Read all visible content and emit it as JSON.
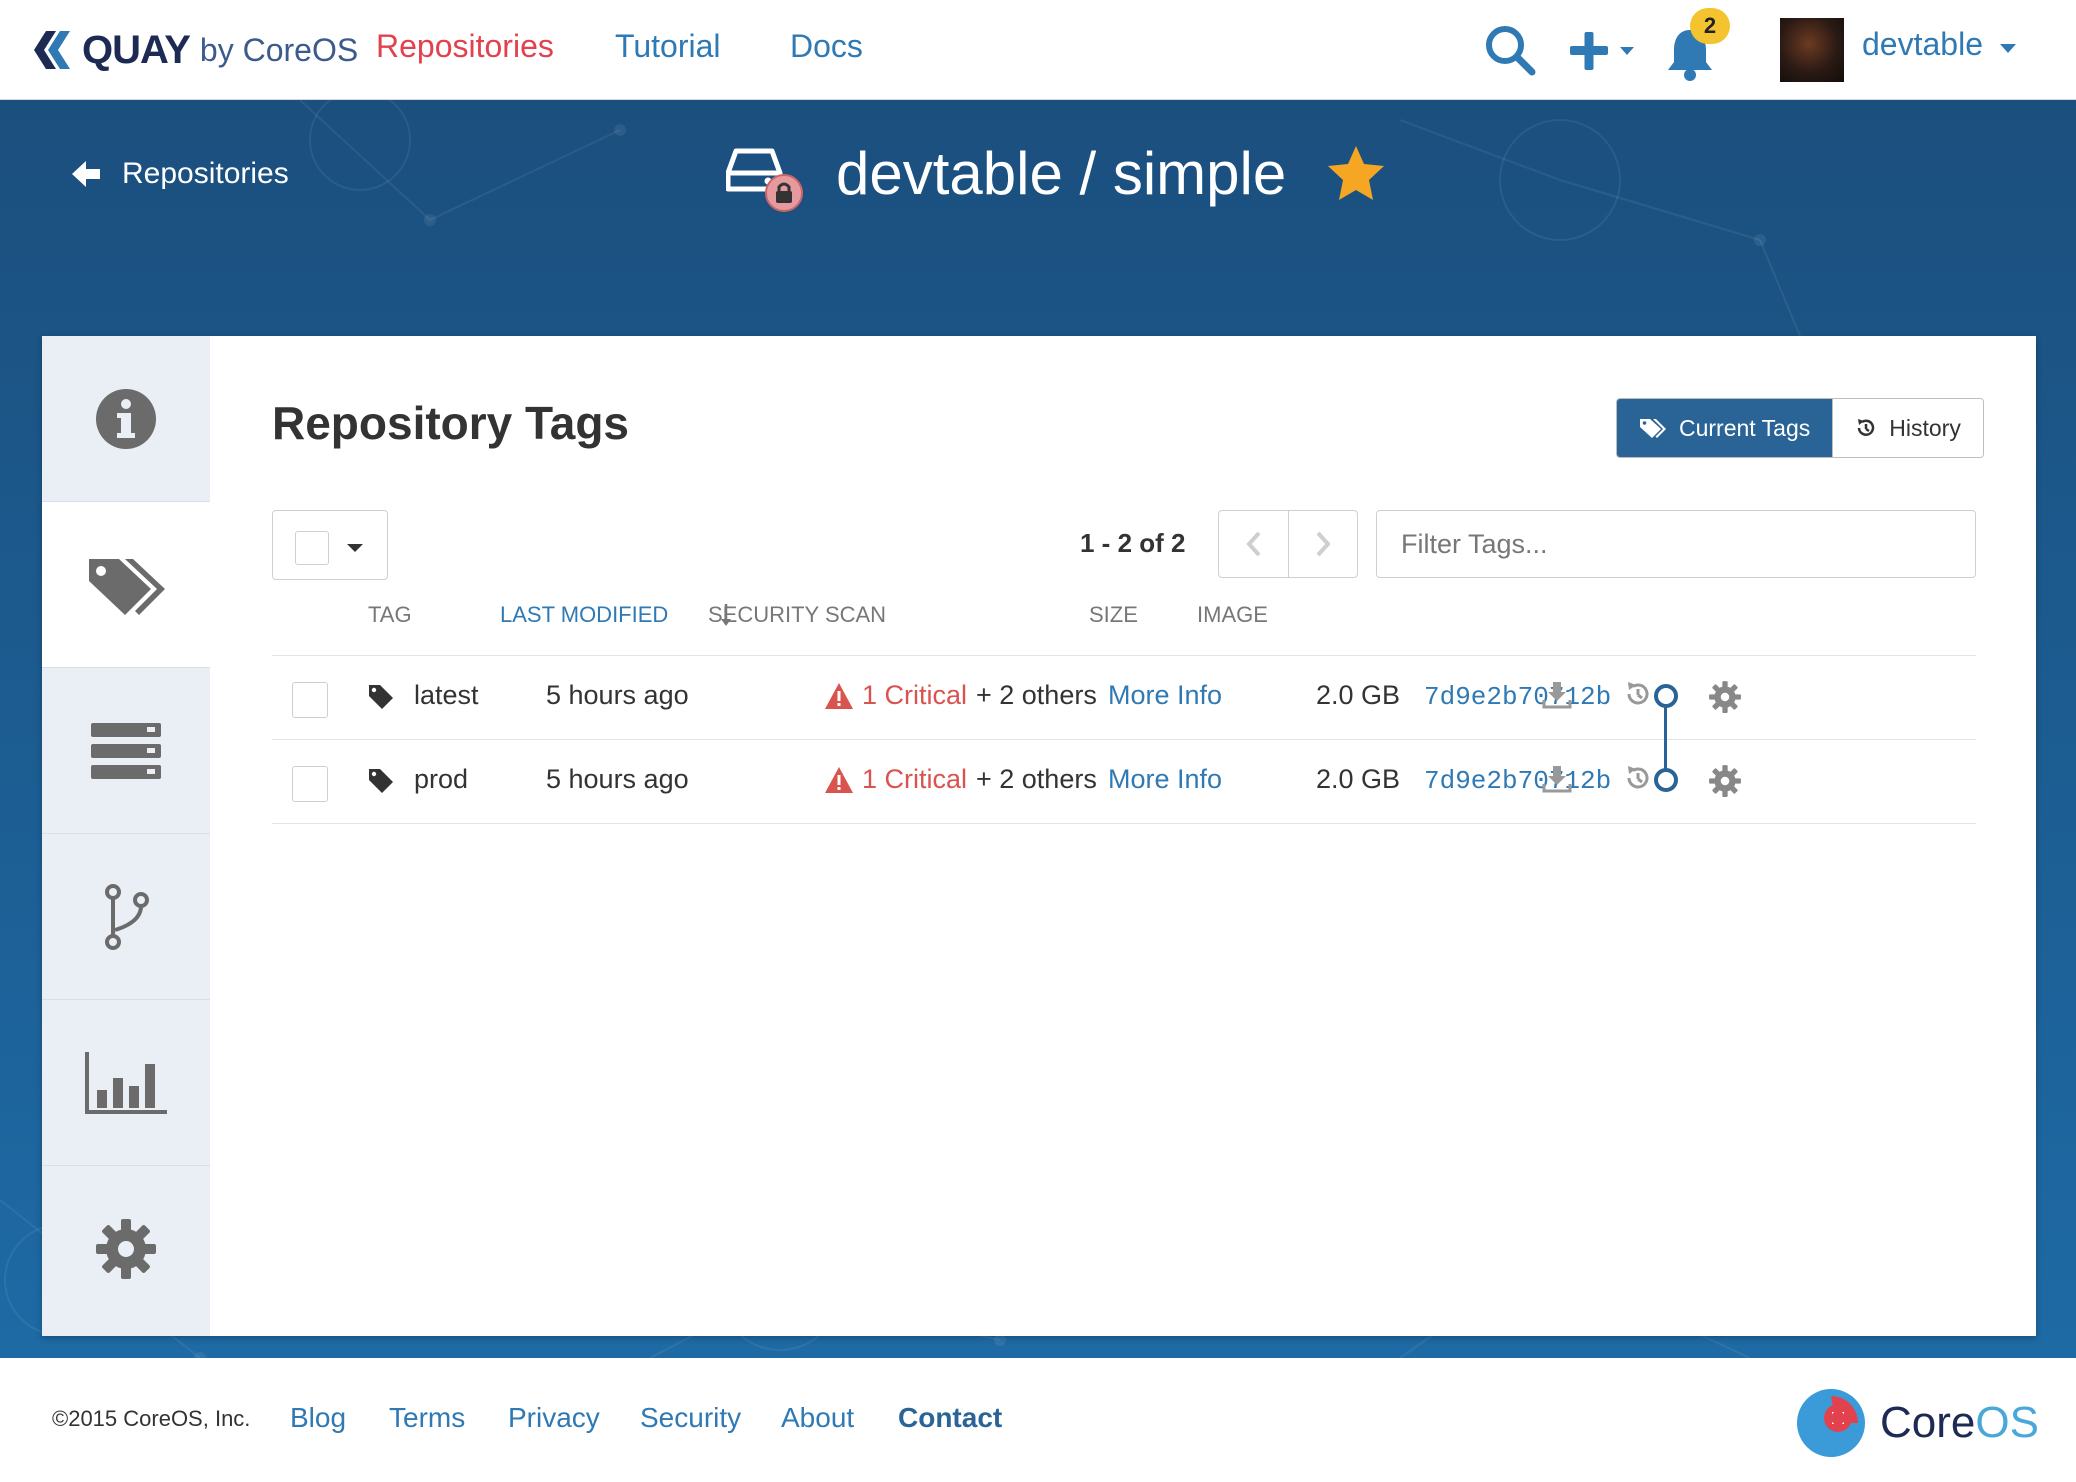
{
  "nav": {
    "brand_word": "QUAY",
    "brand_by": "by CoreOS",
    "links": [
      "Repositories",
      "Tutorial",
      "Docs"
    ],
    "notification_count": "2",
    "username": "devtable",
    "colors": {
      "active": "#e2424e",
      "link": "#2f79b4",
      "badge": "#f4c430"
    }
  },
  "header": {
    "back_label": "Repositories",
    "repo_title": "devtable / simple",
    "starred": true
  },
  "sidebar": {
    "items": [
      {
        "icon": "info-icon"
      },
      {
        "icon": "tags-icon",
        "active": true
      },
      {
        "icon": "layers-icon"
      },
      {
        "icon": "branch-icon"
      },
      {
        "icon": "bar-chart-icon"
      },
      {
        "icon": "gear-icon"
      }
    ]
  },
  "tags_panel": {
    "heading": "Repository Tags",
    "toggle": {
      "current": "Current Tags",
      "history": "History"
    },
    "page_count": "1 - 2 of 2",
    "filter_placeholder": "Filter Tags...",
    "columns": [
      "TAG",
      "LAST MODIFIED",
      "SECURITY SCAN",
      "SIZE",
      "IMAGE"
    ],
    "rows": [
      {
        "tag": "latest",
        "modified": "5 hours ago",
        "critical": "1 Critical",
        "others": "+ 2 others",
        "more": "More Info",
        "size": "2.0 GB",
        "image": "7d9e2b70712b"
      },
      {
        "tag": "prod",
        "modified": "5 hours ago",
        "critical": "1 Critical",
        "others": "+ 2 others",
        "more": "More Info",
        "size": "2.0 GB",
        "image": "7d9e2b70712b"
      }
    ]
  },
  "footer": {
    "copyright": "©2015 CoreOS, Inc.",
    "links": [
      "Blog",
      "Terms",
      "Privacy",
      "Security",
      "About",
      "Contact"
    ],
    "logo_a": "Core",
    "logo_b": "OS"
  }
}
